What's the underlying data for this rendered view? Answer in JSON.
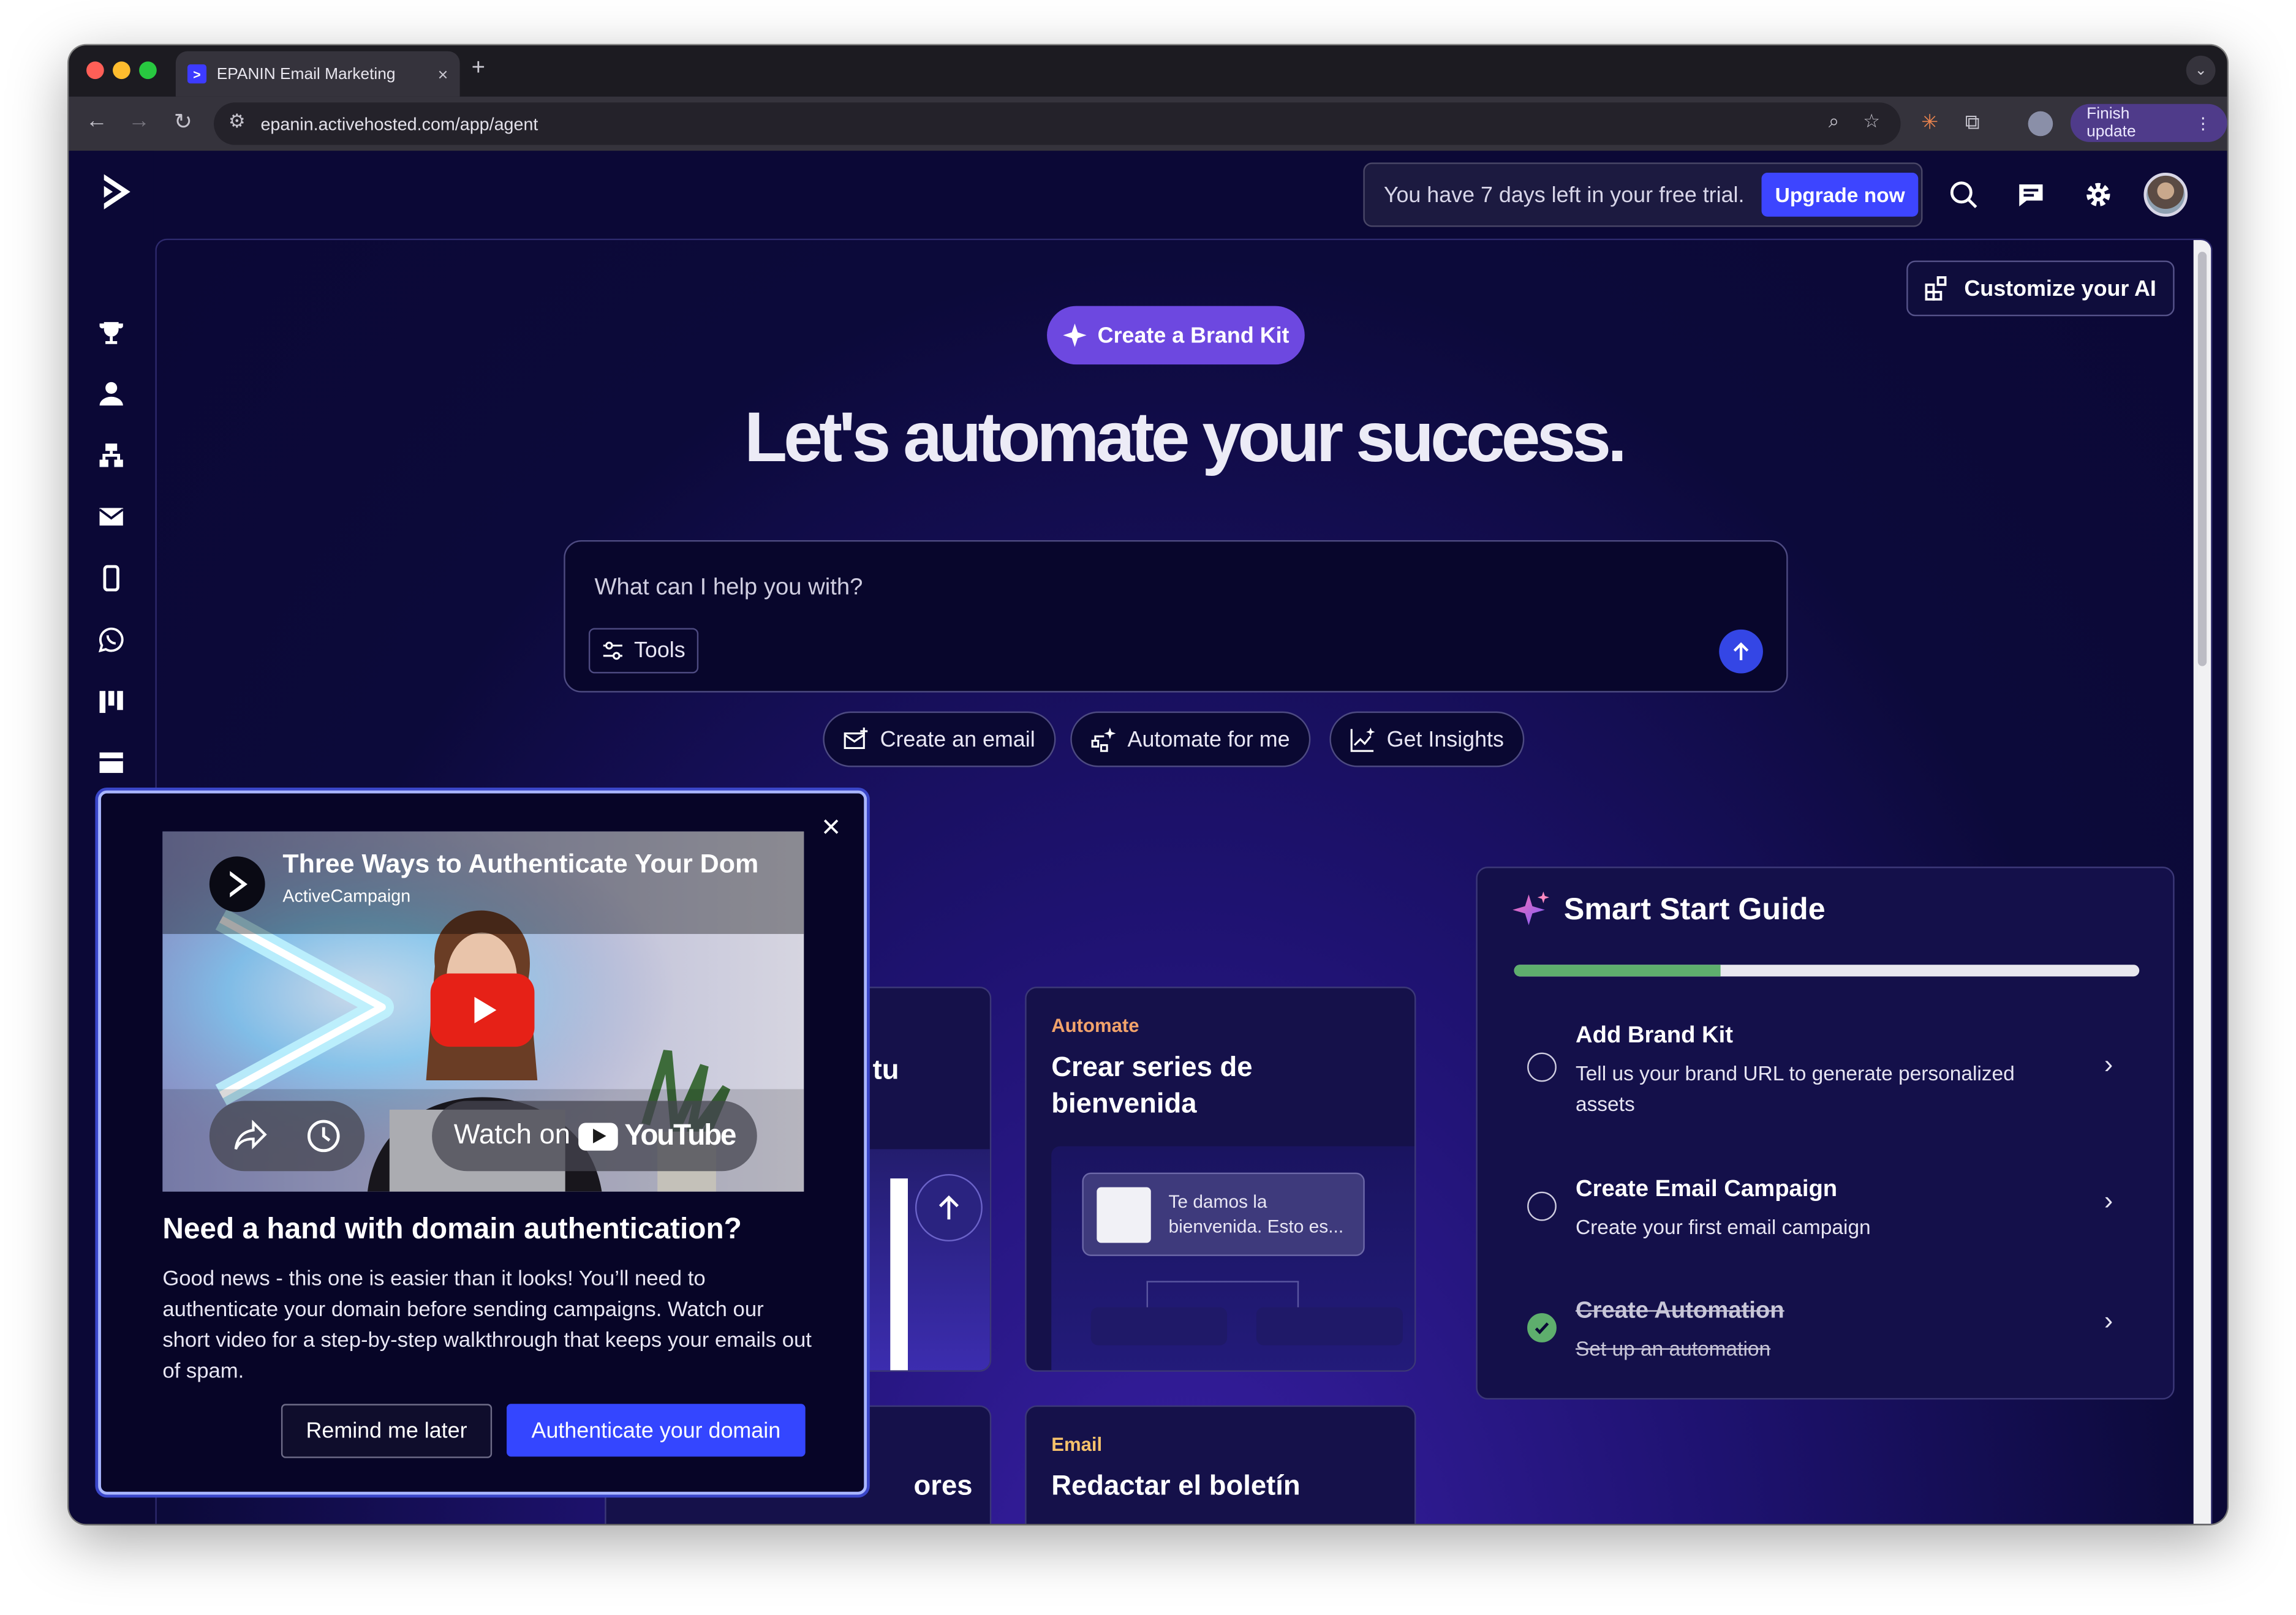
{
  "browser": {
    "tab_title": "EPANIN Email Marketing",
    "new_tab": "+",
    "url": "epanin.activehosted.com/app/agent",
    "finish_update": "Finish update",
    "close_glyph": "×",
    "colors": {
      "tab_active": "#35333c",
      "finish_bg": "#4f3b8a"
    },
    "icons": [
      "back-icon",
      "forward-icon",
      "reload-icon",
      "site-settings-icon",
      "zoom-icon",
      "bookmark-star-icon",
      "extension-icon",
      "puzzle-icon",
      "profile-icon",
      "kebab-menu-icon"
    ]
  },
  "header": {
    "trial_text": "You have 7 days left in your free trial.",
    "upgrade_label": "Upgrade now",
    "icons": [
      "search-icon",
      "chat-icon",
      "gear-icon",
      "avatar"
    ]
  },
  "sidebar": {
    "items": [
      "trophy-icon",
      "contacts-icon",
      "automations-icon",
      "email-icon",
      "mobile-icon",
      "whatsapp-icon",
      "pipeline-icon",
      "pages-icon",
      "reports-icon"
    ]
  },
  "main": {
    "customize_label": "Customize your AI",
    "brand_kit_label": "Create a Brand Kit",
    "hero_title": "Let's automate your success.",
    "prompt_placeholder": "What can I help you with?",
    "tools_label": "Tools",
    "chips": [
      "Create an email",
      "Automate for me",
      "Get Insights"
    ]
  },
  "cards": {
    "partial_title": "tu",
    "automate": {
      "kicker": "Automate",
      "title": "Crear series de bienvenida",
      "preview_text": "Te damos la bienvenida. Esto es..."
    },
    "email": {
      "kicker": "Email",
      "title": "Redactar el boletín"
    },
    "bottom_partial": "ores"
  },
  "smart_start": {
    "title": "Smart Start Guide",
    "progress": 0.33,
    "steps": [
      {
        "title": "Add Brand Kit",
        "desc": "Tell us your brand URL to generate personalized assets",
        "done": false
      },
      {
        "title": "Create Email Campaign",
        "desc": "Create your first email campaign",
        "done": false
      },
      {
        "title": "Create Automation",
        "desc": "Set up an automation",
        "done": true
      }
    ]
  },
  "popup": {
    "video_title": "Three Ways to Authenticate Your Dom",
    "video_channel": "ActiveCampaign",
    "watch_on": "Watch on",
    "youtube": "YouTube",
    "heading": "Need a hand with domain authentication?",
    "body": "Good news - this one is easier than it looks!  You’ll need to authenticate your domain before sending campaigns. Watch our short video for a step-by-step walkthrough that keeps your emails out of spam.",
    "remind_label": "Remind me later",
    "auth_label": "Authenticate your domain",
    "close_glyph": "×"
  },
  "colors": {
    "app_bg": "#0b0836",
    "accent": "#3d45ff",
    "brand_kit": "#6d48e0",
    "kicker": "#f2a36b",
    "progress": "#5eae6d"
  }
}
